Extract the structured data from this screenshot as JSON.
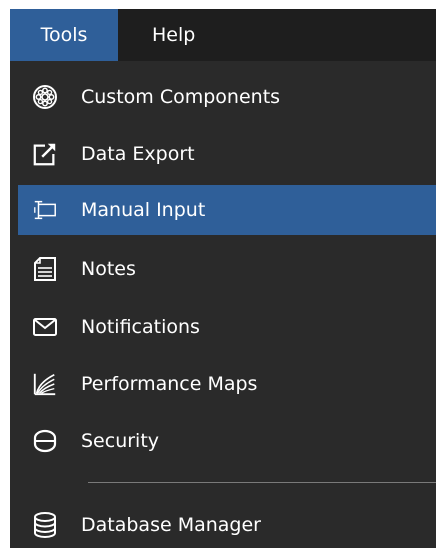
{
  "menubar": {
    "tools_label": "Tools",
    "help_label": "Help",
    "active_color": "#2f5f99"
  },
  "menu": {
    "items": [
      {
        "label": "Custom Components",
        "icon": "gear-ring-icon"
      },
      {
        "label": "Data Export",
        "icon": "export-arrow-icon"
      },
      {
        "label": "Manual Input",
        "icon": "text-input-icon",
        "highlighted": true
      },
      {
        "label": "Notes",
        "icon": "notes-icon"
      },
      {
        "label": "Notifications",
        "icon": "envelope-icon"
      },
      {
        "label": "Performance Maps",
        "icon": "performance-map-icon"
      },
      {
        "label": "Security",
        "icon": "shield-icon"
      },
      {
        "label": "Database Manager",
        "icon": "database-icon"
      }
    ]
  },
  "colors": {
    "background": "#2a2a2a",
    "menubar": "#1e1e1e",
    "highlight": "#2f5f99",
    "text": "#ffffff"
  }
}
